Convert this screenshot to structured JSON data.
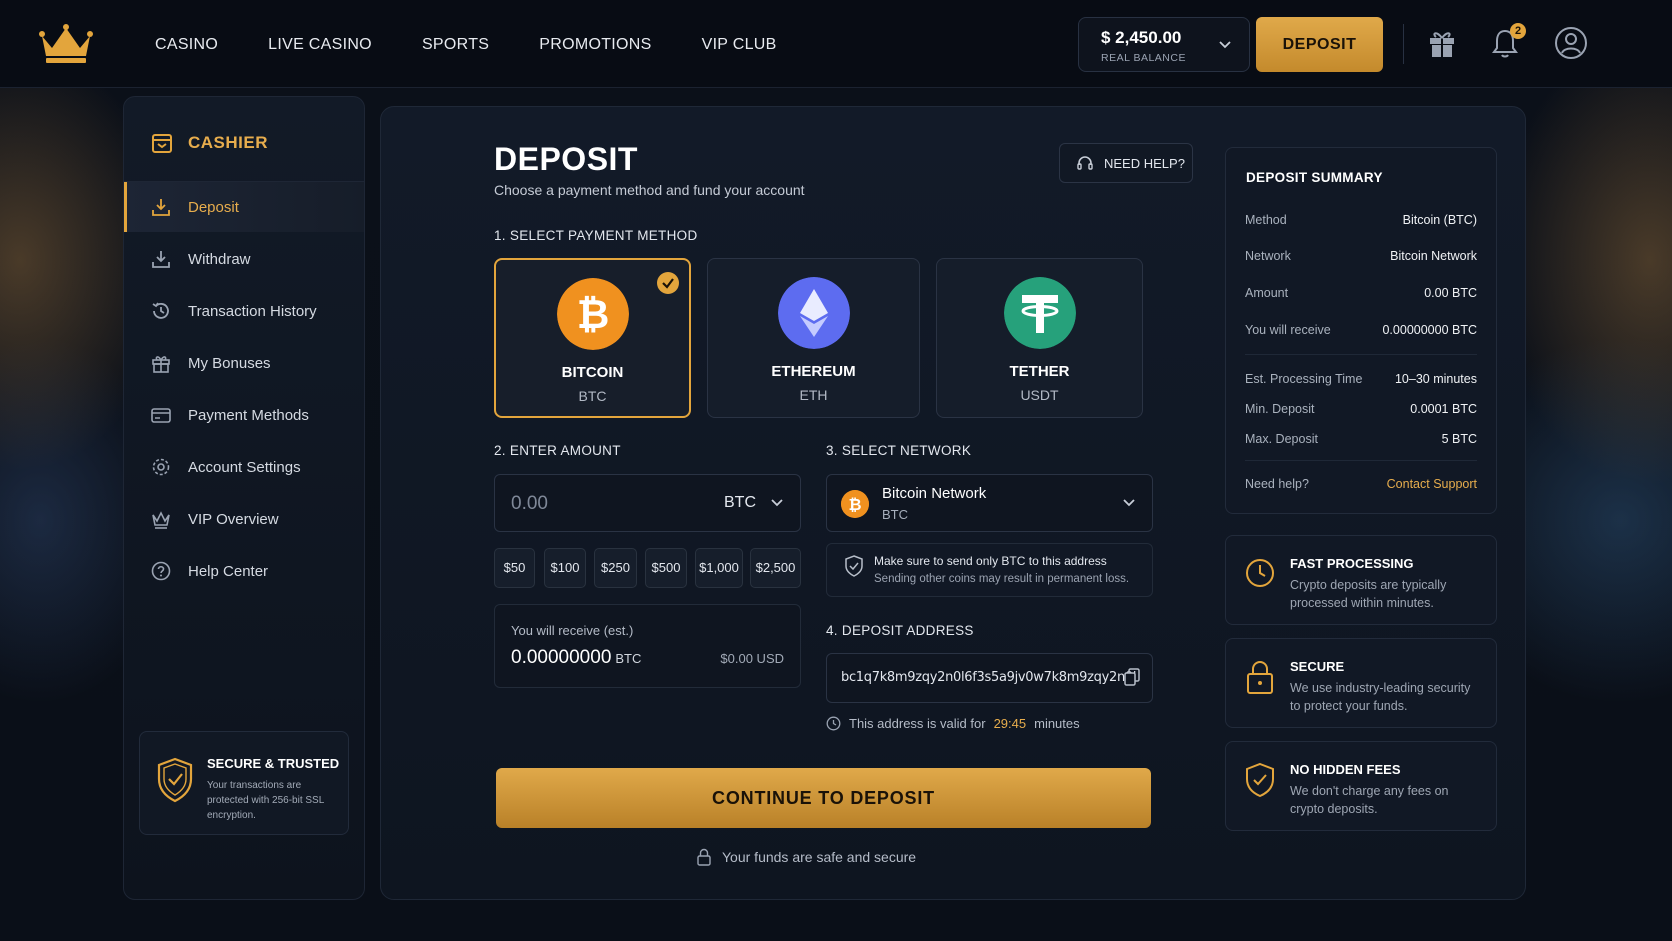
{
  "nav": {
    "items": [
      {
        "label": "CASINO"
      },
      {
        "label": "LIVE CASINO"
      },
      {
        "label": "SPORTS"
      },
      {
        "label": "PROMOTIONS"
      },
      {
        "label": "VIP CLUB"
      }
    ]
  },
  "balance": {
    "amount": "$ 2,450.00",
    "label": "REAL BALANCE"
  },
  "header": {
    "deposit_label": "DEPOSIT",
    "notification_count": "2"
  },
  "sidebar": {
    "title": "CASHIER",
    "items": [
      {
        "label": "Deposit",
        "icon": "download-icon",
        "active": true
      },
      {
        "label": "Withdraw",
        "icon": "withdraw-icon"
      },
      {
        "label": "Transaction History",
        "icon": "history-icon"
      },
      {
        "label": "My Bonuses",
        "icon": "gift-icon"
      },
      {
        "label": "Payment Methods",
        "icon": "card-icon"
      },
      {
        "label": "Account Settings",
        "icon": "gear-icon"
      },
      {
        "label": "VIP Overview",
        "icon": "crown-icon"
      },
      {
        "label": "Help Center",
        "icon": "help-icon"
      }
    ],
    "secure": {
      "title": "SECURE & TRUSTED",
      "desc": "Your transactions are protected with 256-bit SSL encryption."
    }
  },
  "main": {
    "title": "DEPOSIT",
    "subtitle": "Choose a payment method and fund your account",
    "help_label": "NEED HELP?",
    "step1": "1. SELECT PAYMENT METHOD",
    "methods": [
      {
        "name": "BITCOIN",
        "ticker": "BTC",
        "selected": true,
        "color": "#f0911f"
      },
      {
        "name": "ETHEREUM",
        "ticker": "ETH",
        "selected": false,
        "color": "#5d6cf0"
      },
      {
        "name": "TETHER",
        "ticker": "USDT",
        "selected": false,
        "color": "#26a17b"
      }
    ],
    "step2": "2. ENTER AMOUNT",
    "amount": {
      "placeholder": "0.00",
      "currency": "BTC"
    },
    "quick_amounts": [
      "$50",
      "$100",
      "$250",
      "$500",
      "$1,000",
      "$2,500"
    ],
    "receive": {
      "label": "You will receive (est.)",
      "value": "0.00000000",
      "unit": "BTC",
      "usd": "$0.00 USD"
    },
    "step3": "3. SELECT NETWORK",
    "network": {
      "name": "Bitcoin Network",
      "ticker": "BTC"
    },
    "warning": {
      "line1": "Make sure to send only BTC to this address",
      "line2": "Sending other coins may result in permanent loss."
    },
    "step4": "4. DEPOSIT ADDRESS",
    "address": "bc1q7k8m9zqy2n0l6f3s5a9jv0w7k8m9zqy2n0l",
    "valid": {
      "prefix": "This address is valid for",
      "time": "29:45",
      "suffix": "minutes"
    },
    "continue_label": "CONTINUE TO DEPOSIT",
    "safe_text": "Your funds are safe and secure"
  },
  "summary": {
    "title": "DEPOSIT SUMMARY",
    "rows": [
      {
        "k": "Method",
        "v": "Bitcoin (BTC)"
      },
      {
        "k": "Network",
        "v": "Bitcoin Network"
      },
      {
        "k": "Amount",
        "v": "0.00 BTC"
      },
      {
        "k": "You will receive",
        "v": "0.00000000 BTC"
      },
      {
        "k": "Est. Processing Time",
        "v": "10–30 minutes"
      },
      {
        "k": "Min. Deposit",
        "v": "0.0001 BTC"
      },
      {
        "k": "Max. Deposit",
        "v": "5 BTC"
      }
    ],
    "help_label": "Need help?",
    "help_link": "Contact Support"
  },
  "features": [
    {
      "title": "FAST PROCESSING",
      "desc": "Crypto deposits are typically processed within minutes.",
      "icon": "clock-icon"
    },
    {
      "title": "SECURE",
      "desc": "We use industry-leading security to protect your funds.",
      "icon": "lock-icon"
    },
    {
      "title": "NO HIDDEN FEES",
      "desc": "We don't charge any fees on crypto deposits.",
      "icon": "shield-check-icon"
    }
  ],
  "colors": {
    "accent": "#e3a53c",
    "bg": "#0a0f18",
    "panel": "#121a28"
  }
}
